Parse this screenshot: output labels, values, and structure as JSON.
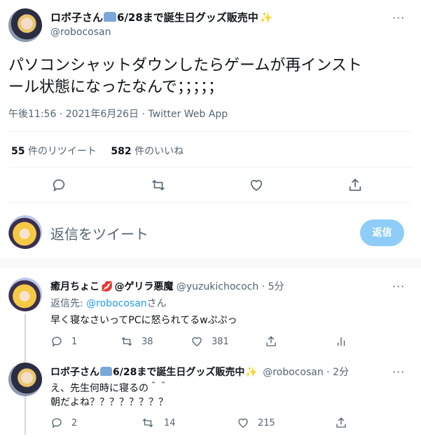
{
  "main_tweet": {
    "author_name": "ロボ子さん",
    "name_suffix": "6/28まで誕生日グッズ販売中",
    "handle": "@robocosan",
    "text_line1": "パソコンシャットダウンしたらゲームが再インスト",
    "text_line2": "ール状態になったなんで；；；；；",
    "timestamp": "午後11:56 · 2021年6月26日 · Twitter Web App",
    "retweets_count": "55",
    "retweets_label": "件のリツイート",
    "likes_count": "582",
    "likes_label": "件のいいね",
    "more": "···"
  },
  "reply_box": {
    "placeholder": "返信をツイート",
    "button_label": "返信"
  },
  "replies": [
    {
      "author_name": "癒月ちょこ",
      "name_suffix": "@ゲリラ悪魔",
      "handle": "@yuzukichococh",
      "time": "· 5分",
      "reply_to_label": "返信先: ",
      "reply_to_handle": "@robocosan",
      "reply_to_suffix": "さん",
      "text": "早く寝なさいってPCに怒られてるwぷぷっ",
      "replies": "1",
      "retweets": "38",
      "likes": "381",
      "more": "···"
    },
    {
      "author_name": "ロボ子さん",
      "name_suffix": "6/28まで誕生日グッズ販売中",
      "handle": "@robocosan",
      "time": "· 2分",
      "text_line1": "え、先生何時に寝るの＾＾",
      "text_line2": "朝だよね？？？？？？？？",
      "replies": "2",
      "retweets": "14",
      "likes": "215",
      "more": "···"
    }
  ],
  "colors": {
    "accent": "#1d9bf0",
    "text": "#0f1419",
    "secondary": "#536471"
  }
}
